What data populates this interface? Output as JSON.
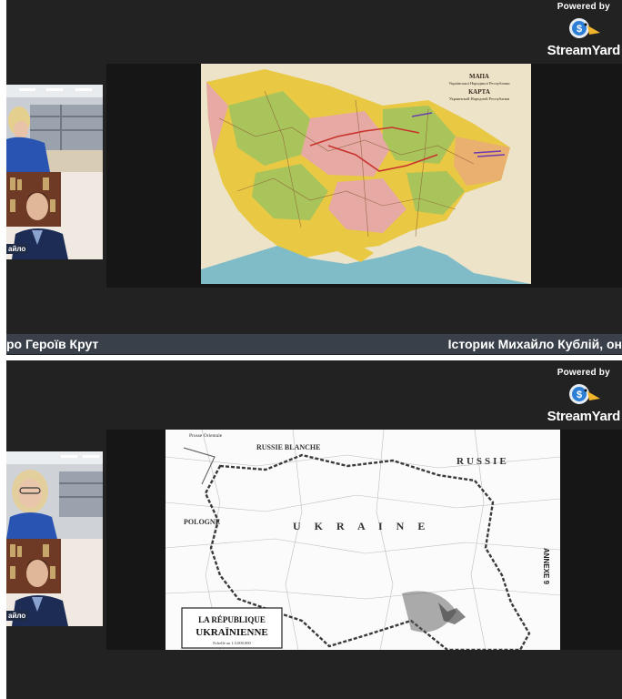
{
  "branding": {
    "powered_by": "Powered by",
    "brand_name_part1": "Stream",
    "brand_name_part2": "Yard"
  },
  "top_panel": {
    "lower_third_left": "ро Героїв Крут",
    "lower_third_right": "Історик Михайло Кублій, он",
    "cam_name_tag": "айло",
    "map_title_lines": [
      "МАПА",
      "Української Народньої Республики",
      "КАРТА",
      "Украинской Народной Республики"
    ]
  },
  "bottom_panel": {
    "cam_name_tag": "айло",
    "map_labels": {
      "russie_blanche": "RUSSIE BLANCHE",
      "russie": "RUSSIE",
      "ukraine": "U K R A I N E",
      "pologne": "POLOGNE",
      "annexe": "ANNEXE 9",
      "prusse": "Prusse Orientale",
      "cartouche_line1": "LA RÉPUBLIQUE",
      "cartouche_line2": "UKRAÏNIENNE",
      "cartouche_scale": "Echelle au 1:3.000.000"
    }
  },
  "colors": {
    "background": "#222222",
    "lower_third": "#3a4049",
    "map_green": "#a9c45a",
    "map_yellow": "#e9c843",
    "map_pink": "#e6a9a3",
    "map_sea": "#7fbcc7"
  }
}
